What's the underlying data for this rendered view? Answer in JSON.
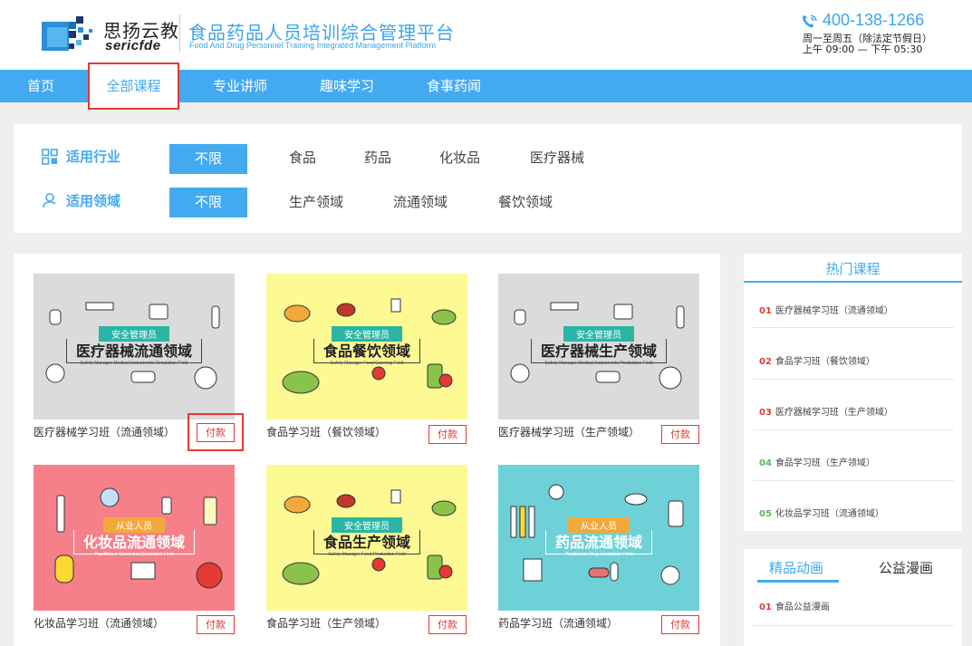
{
  "header": {
    "brand_cn": "思扬云教",
    "brand_en": "sericfde",
    "platform_cn": "食品药品人员培训综合管理平台",
    "platform_en": "Food And Drug Personnel Training Integrated Management Platform",
    "phone": "400-138-1266",
    "hours_line1": "周一至周五（除法定节假日）",
    "hours_line2": "上午 09:00 — 下午 05:30"
  },
  "nav": {
    "items": [
      "首页",
      "全部课程",
      "专业讲师",
      "趣味学习",
      "食事药闻"
    ],
    "active": "全部课程"
  },
  "filter": {
    "industry_label": "适用行业",
    "industry_selected": "不限",
    "industry_options": [
      "食品",
      "药品",
      "化妆品",
      "医疗器械"
    ],
    "field_label": "适用领域",
    "field_selected": "不限",
    "field_options": [
      "生产领域",
      "流通领域",
      "餐饮领域"
    ]
  },
  "courses": [
    {
      "name": "医疗器械学习班（流通领域）",
      "pay": "付款",
      "banner_small": "安全管理员",
      "banner_big": "医疗器械流通领域",
      "banner_en": "Safety Manager Medical Instruments Circulation Field",
      "bg": "#d9dcdb"
    },
    {
      "name": "食品学习班（餐饮领域）",
      "pay": "付款",
      "banner_small": "安全管理员",
      "banner_big": "食品餐饮领域",
      "banner_en": "Safety Manager Food Catering Field",
      "bg": "#fdf993"
    },
    {
      "name": "医疗器械学习班（生产领域）",
      "pay": "付款",
      "banner_small": "安全管理员",
      "banner_big": "医疗器械生产领域",
      "banner_en": "Safety Manager Medical Instruments Production Field",
      "bg": "#d9dcdb"
    },
    {
      "name": "化妆品学习班（流通领域）",
      "pay": "付款",
      "banner_small": "从业人员",
      "banner_big": "化妆品流通领域",
      "banner_en": "Practitioner Cosmetics Circulation Field",
      "bg": "#f6808a"
    },
    {
      "name": "食品学习班（生产领域）",
      "pay": "付款",
      "banner_small": "安全管理员",
      "banner_big": "食品生产领域",
      "banner_en": "Safety Manager Food Production Field",
      "bg": "#fdf993"
    },
    {
      "name": "药品学习班（流通领域）",
      "pay": "付款",
      "banner_small": "从业人员",
      "banner_big": "药品流通领域",
      "banner_en": "Practitioner Drug Circulation Field",
      "bg": "#6fd1d8"
    }
  ],
  "hot": {
    "title": "热门课程",
    "items": [
      {
        "num": "01",
        "label": "医疗器械学习班（流通领域）",
        "color": "#e53935"
      },
      {
        "num": "02",
        "label": "食品学习班（餐饮领域）",
        "color": "#e53935"
      },
      {
        "num": "03",
        "label": "医疗器械学习班（生产领域）",
        "color": "#e53935"
      },
      {
        "num": "04",
        "label": "食品学习班（生产领域）",
        "color": "#5cb85c"
      },
      {
        "num": "05",
        "label": "化妆品学习班（流通领域）",
        "color": "#5cb85c"
      }
    ]
  },
  "anim": {
    "tab1": "精品动画",
    "tab2": "公益漫画",
    "items": [
      {
        "num": "01",
        "label": "食品公益漫画"
      }
    ]
  },
  "colors": {
    "accent": "#44aaf0",
    "danger": "#e53935",
    "green": "#5cb85c"
  }
}
